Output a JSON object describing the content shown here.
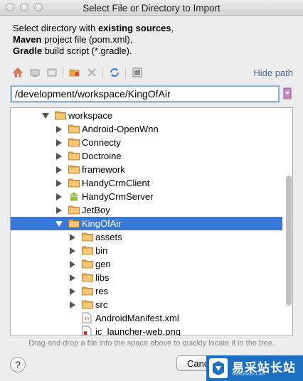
{
  "window": {
    "title": "Select File or Directory to Import"
  },
  "description": {
    "line1_prefix": "Select directory with ",
    "line1_bold": "existing sources",
    "line1_suffix": ",",
    "line2_bold": "Maven",
    "line2_rest": " project file (pom.xml),",
    "line3_bold": "Gradle",
    "line3_rest": " build script (*.gradle)."
  },
  "toolbar": {
    "icons": [
      "home-icon",
      "desktop-icon",
      "project-icon",
      "new-folder-icon",
      "delete-icon",
      "refresh-icon",
      "show-hidden-icon"
    ],
    "hide_path_label": "Hide path"
  },
  "path": {
    "value": "/development/workspace/KingOfAir"
  },
  "tree": {
    "items": [
      {
        "label": "workspace",
        "state": "expanded",
        "icon": "folder-icon"
      },
      {
        "label": "Android-OpenWnn",
        "state": "collapsed",
        "icon": "folder-icon"
      },
      {
        "label": "Connecty",
        "state": "collapsed",
        "icon": "folder-icon"
      },
      {
        "label": "Doctroine",
        "state": "collapsed",
        "icon": "folder-icon"
      },
      {
        "label": "framework",
        "state": "collapsed",
        "icon": "folder-icon"
      },
      {
        "label": "HandyCrmClient",
        "state": "collapsed",
        "icon": "folder-icon"
      },
      {
        "label": "HandyCrmServer",
        "state": "collapsed",
        "icon": "android-project-icon"
      },
      {
        "label": "JetBoy",
        "state": "collapsed",
        "icon": "folder-icon"
      },
      {
        "label": "KingOfAir",
        "state": "expanded",
        "icon": "folder-icon",
        "selected": true
      },
      {
        "label": "assets",
        "state": "collapsed",
        "icon": "folder-icon"
      },
      {
        "label": "bin",
        "state": "collapsed",
        "icon": "folder-icon"
      },
      {
        "label": "gen",
        "state": "collapsed",
        "icon": "folder-icon"
      },
      {
        "label": "libs",
        "state": "collapsed",
        "icon": "folder-icon"
      },
      {
        "label": "res",
        "state": "collapsed",
        "icon": "folder-icon"
      },
      {
        "label": "src",
        "state": "collapsed",
        "icon": "folder-icon"
      },
      {
        "label": "AndroidManifest.xml",
        "state": "leaf",
        "icon": "xml-file-icon"
      },
      {
        "label": "ic_launcher-web.png",
        "state": "leaf",
        "icon": "image-file-icon"
      }
    ]
  },
  "hint": "Drag and drop a file into the space above to quickly locate it in the tree.",
  "buttons": {
    "help": "?",
    "cancel": "Canc",
    "ok": ""
  },
  "watermark": {
    "text": "易采站长站",
    "sub": "Www.Easck.Com"
  },
  "colors": {
    "selection": "#3879d9",
    "folder": "#e9a84a",
    "link": "#4a6b9e"
  }
}
